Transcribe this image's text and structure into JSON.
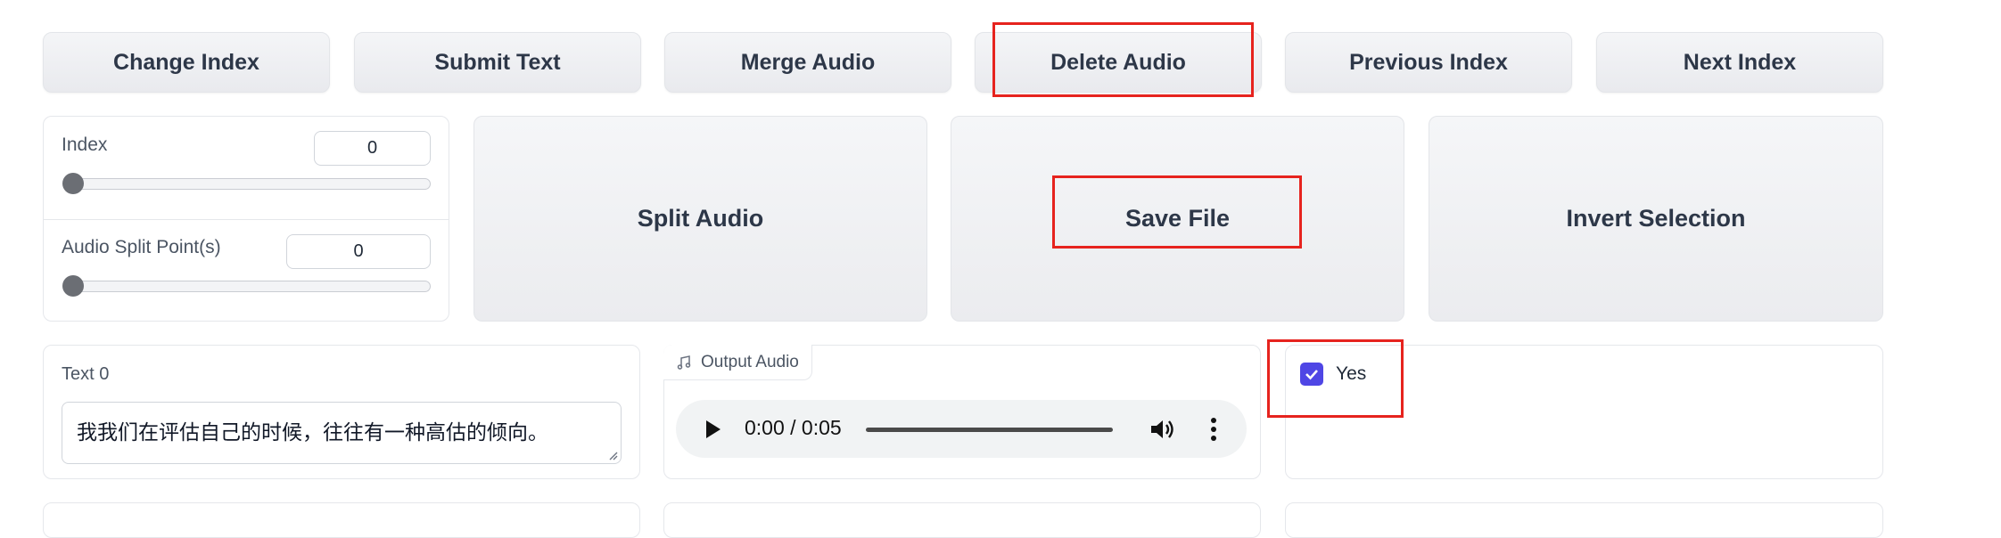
{
  "toolbar": {
    "change_index": "Change Index",
    "submit_text": "Submit Text",
    "merge_audio": "Merge Audio",
    "delete_audio": "Delete Audio",
    "previous_index": "Previous Index",
    "next_index": "Next Index"
  },
  "sliders": {
    "index_label": "Index",
    "index_value": "0",
    "split_label": "Audio Split Point(s)",
    "split_value": "0"
  },
  "actions": {
    "split_audio": "Split Audio",
    "save_file": "Save File",
    "invert_selection": "Invert Selection"
  },
  "text_block": {
    "label": "Text 0",
    "value": "我我们在评估自己的时候，往往有一种高估的倾向。"
  },
  "audio": {
    "label": "Output Audio",
    "time": "0:00 / 0:05",
    "progress_fraction": 0
  },
  "checkbox": {
    "label": "Yes",
    "checked": true
  },
  "colors": {
    "highlight": "#e6231e",
    "checkbox": "#4f46e5"
  }
}
